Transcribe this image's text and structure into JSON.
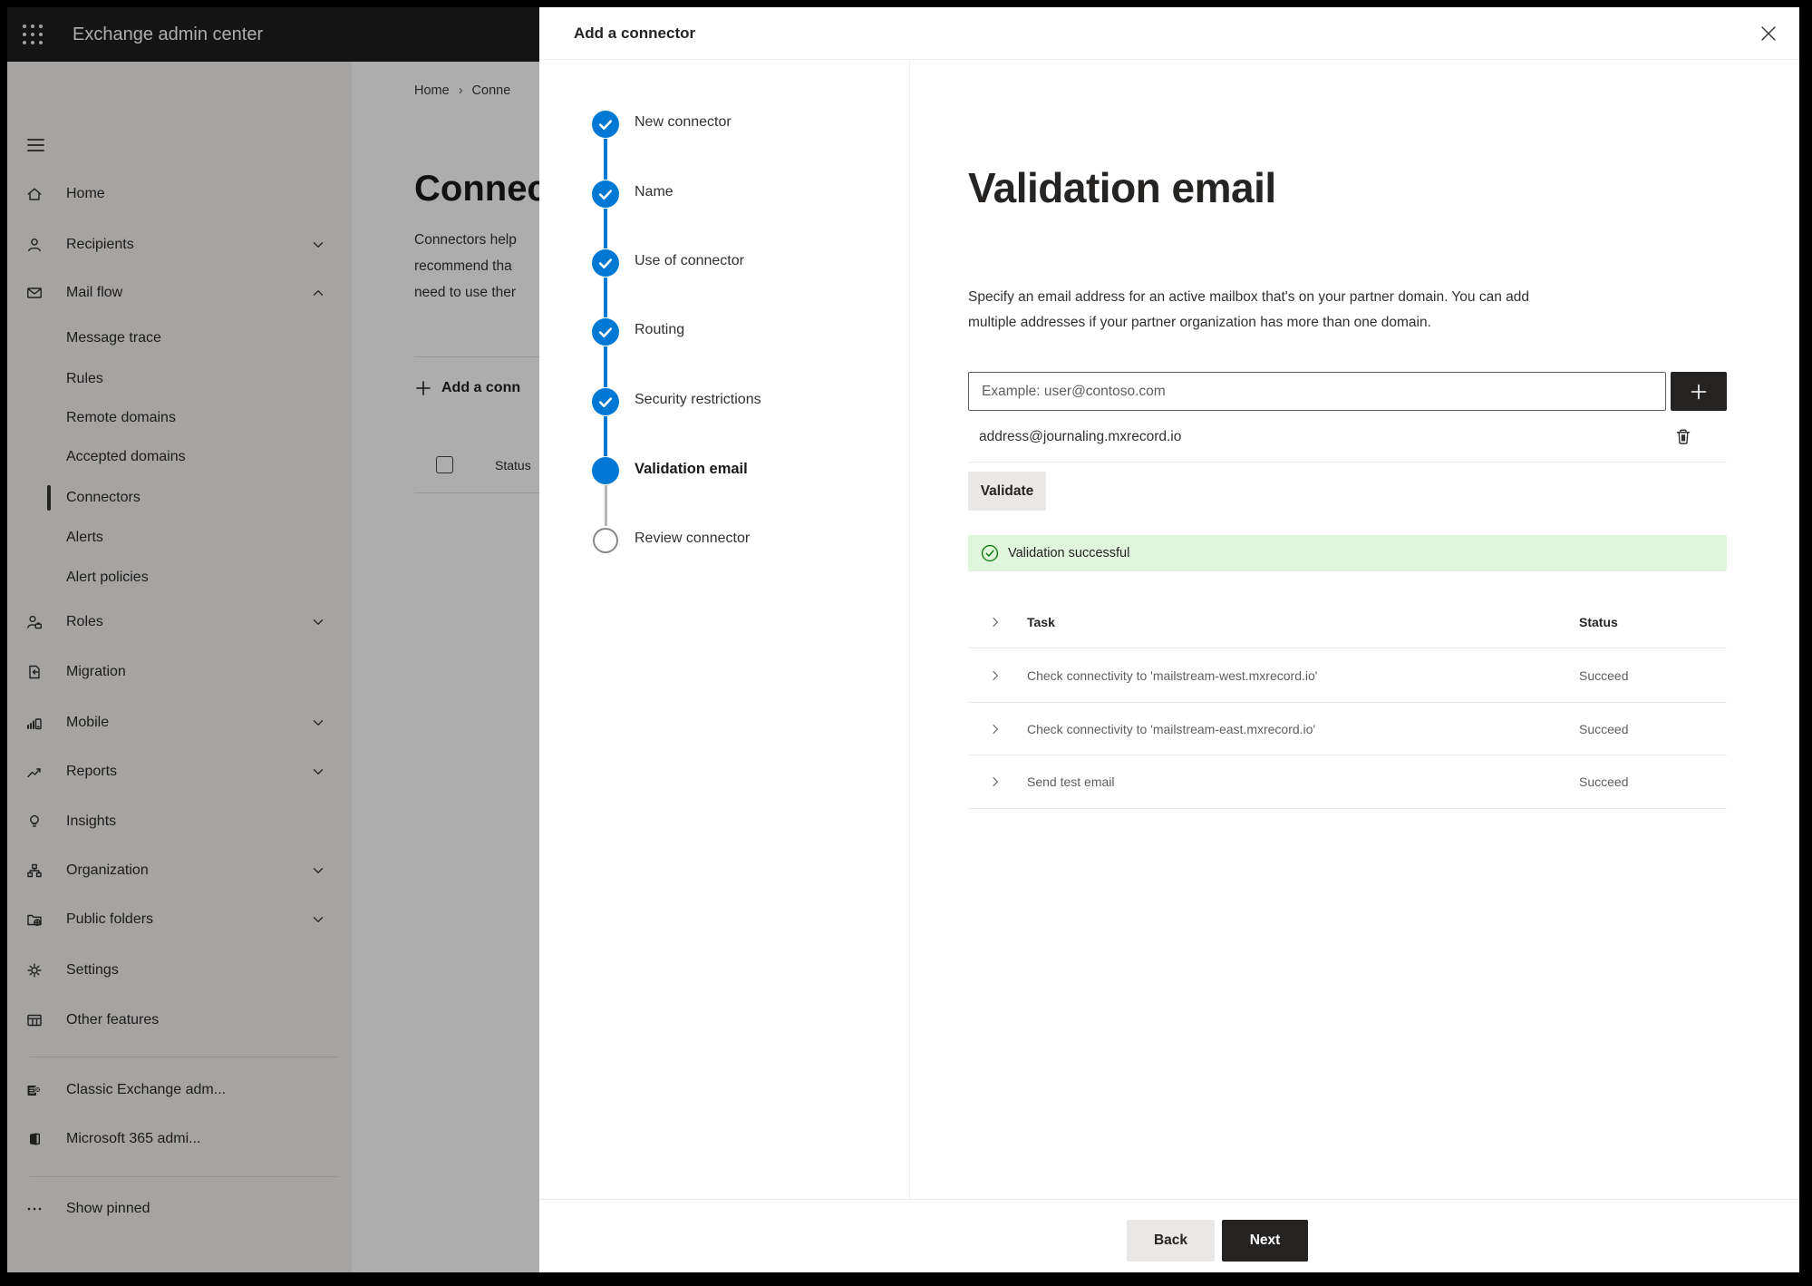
{
  "topbar": {
    "title": "Exchange admin center"
  },
  "sidebar": {
    "items": [
      {
        "label": "Home",
        "icon": "home-icon"
      },
      {
        "label": "Recipients",
        "icon": "person-icon",
        "chevron": "down"
      },
      {
        "label": "Mail flow",
        "icon": "mail-icon",
        "chevron": "up",
        "expanded": true
      },
      {
        "label": "Message trace",
        "sub": true
      },
      {
        "label": "Rules",
        "sub": true
      },
      {
        "label": "Remote domains",
        "sub": true
      },
      {
        "label": "Accepted domains",
        "sub": true
      },
      {
        "label": "Connectors",
        "sub": true,
        "selected": true
      },
      {
        "label": "Alerts",
        "sub": true
      },
      {
        "label": "Alert policies",
        "sub": true
      },
      {
        "label": "Roles",
        "icon": "roles-icon",
        "chevron": "down"
      },
      {
        "label": "Migration",
        "icon": "migration-icon"
      },
      {
        "label": "Mobile",
        "icon": "mobile-icon",
        "chevron": "down"
      },
      {
        "label": "Reports",
        "icon": "reports-icon",
        "chevron": "down"
      },
      {
        "label": "Insights",
        "icon": "lightbulb-icon"
      },
      {
        "label": "Organization",
        "icon": "org-chart-icon",
        "chevron": "down"
      },
      {
        "label": "Public folders",
        "icon": "folder-globe-icon",
        "chevron": "down"
      },
      {
        "label": "Settings",
        "icon": "gear-icon"
      },
      {
        "label": "Other features",
        "icon": "table-icon"
      },
      {
        "label": "Classic Exchange adm...",
        "icon": "exchange-logo-icon"
      },
      {
        "label": "Microsoft 365 admi...",
        "icon": "office-logo-icon"
      },
      {
        "label": "Show pinned",
        "icon": "ellipsis-icon"
      }
    ]
  },
  "background": {
    "breadcrumb": {
      "home": "Home",
      "current": "Conne"
    },
    "heading": "Connec",
    "body_lines": [
      "Connectors help",
      "recommend tha",
      "need to use ther"
    ],
    "add_button": "Add a conn",
    "status_header": "Status"
  },
  "dialog": {
    "title": "Add a connector",
    "steps": [
      {
        "label": "New connector",
        "state": "done"
      },
      {
        "label": "Name",
        "state": "done"
      },
      {
        "label": "Use of connector",
        "state": "done"
      },
      {
        "label": "Routing",
        "state": "done"
      },
      {
        "label": "Security restrictions",
        "state": "done"
      },
      {
        "label": "Validation email",
        "state": "current"
      },
      {
        "label": "Review connector",
        "state": "todo"
      }
    ],
    "content": {
      "heading": "Validation email",
      "description_line1": "Specify an email address for an active mailbox that's on your partner domain. You can add",
      "description_line2": "multiple addresses if your partner organization has more than one domain.",
      "input_placeholder": "Example: user@contoso.com",
      "address": "address@journaling.mxrecord.io",
      "validate_label": "Validate",
      "success_text": "Validation successful",
      "table": {
        "headers": {
          "task": "Task",
          "status": "Status"
        },
        "rows": [
          {
            "task": "Check connectivity to 'mailstream-west.mxrecord.io'",
            "status": "Succeed"
          },
          {
            "task": "Check connectivity to 'mailstream-east.mxrecord.io'",
            "status": "Succeed"
          },
          {
            "task": "Send test email",
            "status": "Succeed"
          }
        ]
      }
    },
    "footer": {
      "back": "Back",
      "next": "Next"
    }
  },
  "colors": {
    "accent_blue": "#0078d4",
    "success_green": "#107c10",
    "success_bg": "#dff6dd",
    "dark_button": "#252423"
  }
}
